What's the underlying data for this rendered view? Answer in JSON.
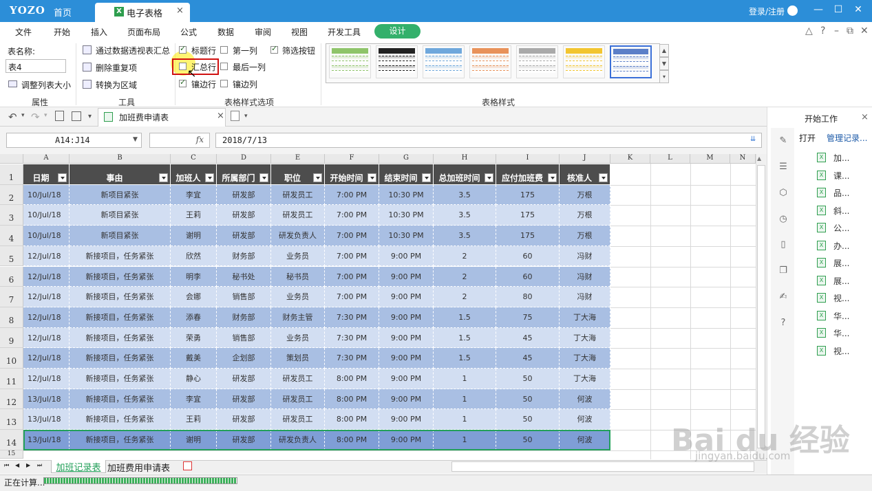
{
  "titlebar": {
    "logo": "YOZO",
    "home": "首页",
    "tab": "电子表格",
    "tab_close": "×",
    "login": "登录/注册",
    "min": "—",
    "max": "☐",
    "close": "✕"
  },
  "menu": {
    "items": [
      "文件",
      "开始",
      "插入",
      "页面布局",
      "公式",
      "数据",
      "审阅",
      "视图",
      "开发工具"
    ],
    "design": "设计",
    "right_icons": [
      "△",
      "?",
      "–",
      "⧉",
      "✕"
    ]
  },
  "ribbon": {
    "properties": {
      "name_label": "表名称:",
      "name_value": "表4",
      "resize": "调整列表大小",
      "group": "属性"
    },
    "tools": {
      "pivot": "通过数据透视表汇总",
      "dedupe": "删除重复项",
      "to_range": "转换为区域",
      "group": "工具"
    },
    "options": {
      "header_row": "标题行",
      "first_col": "第一列",
      "filter_btn": "筛选按钮",
      "total_row": "汇总行",
      "last_col": "最后一列",
      "banded_rows": "镶边行",
      "banded_cols": "镶边列",
      "group": "表格样式选项",
      "checked": {
        "header_row": true,
        "first_col": false,
        "filter_btn": true,
        "total_row": false,
        "last_col": false,
        "banded_rows": true,
        "banded_cols": false
      }
    },
    "styles": {
      "group": "表格样式",
      "swatches": [
        "#8fc46a",
        "#222222",
        "#6fa8dc",
        "#e8925a",
        "#aaaaaa",
        "#f2c530",
        "#5b7fc8"
      ]
    }
  },
  "quickbar": {
    "doc_tab": "加班费申请表",
    "doc_close": "×"
  },
  "formula": {
    "cell_ref": "A14:J14",
    "fx": "fx",
    "value": "2018/7/13"
  },
  "grid": {
    "col_letters": [
      "A",
      "B",
      "C",
      "D",
      "E",
      "F",
      "G",
      "H",
      "I",
      "J",
      "K",
      "L",
      "M",
      "N"
    ],
    "row_numbers": [
      "1",
      "2",
      "3",
      "4",
      "5",
      "6",
      "7",
      "8",
      "9",
      "10",
      "11",
      "12",
      "13",
      "14",
      "15"
    ],
    "headers": [
      "日期",
      "事由",
      "加班人",
      "所属部门",
      "职位",
      "开始时间",
      "结束时间",
      "总加班时间",
      "应付加班费",
      "核准人"
    ],
    "rows": [
      [
        "10/Jul/18",
        "新项目紧张",
        "李宜",
        "研发部",
        "研发员工",
        "7:00 PM",
        "10:30 PM",
        "3.5",
        "175",
        "万根"
      ],
      [
        "10/Jul/18",
        "新项目紧张",
        "王莉",
        "研发部",
        "研发员工",
        "7:00 PM",
        "10:30 PM",
        "3.5",
        "175",
        "万根"
      ],
      [
        "10/Jul/18",
        "新项目紧张",
        "谢明",
        "研发部",
        "研发负责人",
        "7:00 PM",
        "10:30 PM",
        "3.5",
        "175",
        "万根"
      ],
      [
        "12/Jul/18",
        "新接项目，任务紧张",
        "欣然",
        "财务部",
        "业务员",
        "7:00 PM",
        "9:00 PM",
        "2",
        "60",
        "冯财"
      ],
      [
        "12/Jul/18",
        "新接项目，任务紧张",
        "明李",
        "秘书处",
        "秘书员",
        "7:00 PM",
        "9:00 PM",
        "2",
        "60",
        "冯财"
      ],
      [
        "12/Jul/18",
        "新接项目，任务紧张",
        "会娜",
        "销售部",
        "业务员",
        "7:00 PM",
        "9:00 PM",
        "2",
        "80",
        "冯财"
      ],
      [
        "12/Jul/18",
        "新接项目，任务紧张",
        "添春",
        "财务部",
        "财务主管",
        "7:30 PM",
        "9:00 PM",
        "1.5",
        "75",
        "丁大海"
      ],
      [
        "12/Jul/18",
        "新接项目，任务紧张",
        "荣勇",
        "销售部",
        "业务员",
        "7:30 PM",
        "9:00 PM",
        "1.5",
        "45",
        "丁大海"
      ],
      [
        "12/Jul/18",
        "新接项目，任务紧张",
        "戴美",
        "企划部",
        "策划员",
        "7:30 PM",
        "9:00 PM",
        "1.5",
        "45",
        "丁大海"
      ],
      [
        "12/Jul/18",
        "新接项目，任务紧张",
        "静心",
        "研发部",
        "研发员工",
        "8:00 PM",
        "9:00 PM",
        "1",
        "50",
        "丁大海"
      ],
      [
        "13/Jul/18",
        "新接项目，任务紧张",
        "李宜",
        "研发部",
        "研发员工",
        "8:00 PM",
        "9:00 PM",
        "1",
        "50",
        "何波"
      ],
      [
        "13/Jul/18",
        "新接项目，任务紧张",
        "王莉",
        "研发部",
        "研发员工",
        "8:00 PM",
        "9:00 PM",
        "1",
        "50",
        "何波"
      ],
      [
        "13/Jul/18",
        "新接项目，任务紧张",
        "谢明",
        "研发部",
        "研发负责人",
        "8:00 PM",
        "9:00 PM",
        "1",
        "50",
        "何波"
      ]
    ]
  },
  "sheets": {
    "tab1": "加班记录表",
    "tab2": "加班费用申请表",
    "nav": [
      "⏮",
      "◀",
      "▶",
      "⏭"
    ]
  },
  "status": {
    "text": "正在计算..."
  },
  "rightpane": {
    "title": "开始工作",
    "close": "×",
    "open": "打开",
    "manage": "管理记录...",
    "files": [
      "加...",
      "课...",
      "品...",
      "斜...",
      "公...",
      "办...",
      "展...",
      "展...",
      "视...",
      "华...",
      "华...",
      "视..."
    ]
  },
  "watermark": {
    "line1": "Bai du 经验",
    "line2": "jingyan.baidu.com"
  }
}
